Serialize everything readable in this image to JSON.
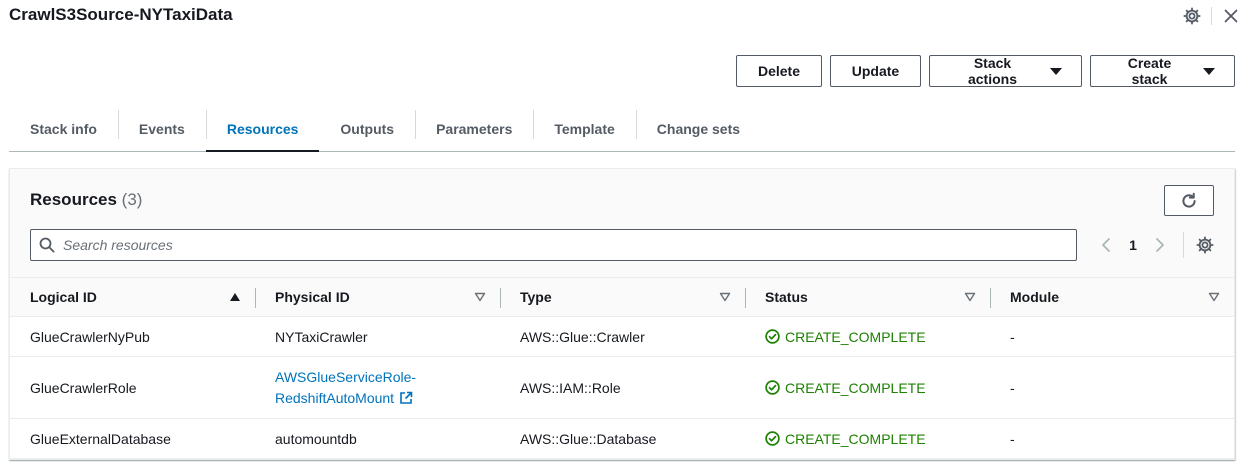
{
  "header": {
    "title": "CrawlS3Source-NYTaxiData",
    "icons": [
      "gear-icon",
      "close-icon"
    ]
  },
  "actions": {
    "delete_label": "Delete",
    "update_label": "Update",
    "stack_actions_label": "Stack actions",
    "create_stack_label": "Create stack"
  },
  "tabs": [
    {
      "label": "Stack info",
      "active": false
    },
    {
      "label": "Events",
      "active": false
    },
    {
      "label": "Resources",
      "active": true
    },
    {
      "label": "Outputs",
      "active": false
    },
    {
      "label": "Parameters",
      "active": false
    },
    {
      "label": "Template",
      "active": false
    },
    {
      "label": "Change sets",
      "active": false
    }
  ],
  "resources": {
    "title": "Resources",
    "count": "(3)",
    "search_placeholder": "Search resources",
    "page": "1",
    "columns": [
      "Logical ID",
      "Physical ID",
      "Type",
      "Status",
      "Module"
    ],
    "sort": {
      "column": "Logical ID",
      "direction": "ascending"
    },
    "rows": [
      {
        "logical_id": "GlueCrawlerNyPub",
        "physical_id": "NYTaxiCrawler",
        "physical_id_2": "",
        "type": "AWS::Glue::Crawler",
        "status": "CREATE_COMPLETE",
        "module": "-"
      },
      {
        "logical_id": "GlueCrawlerRole",
        "physical_id": "AWSGlueServiceRole-",
        "physical_id_2": "RedshiftAutoMount",
        "type": "AWS::IAM::Role",
        "status": "CREATE_COMPLETE",
        "module": "-"
      },
      {
        "logical_id": "GlueExternalDatabase",
        "physical_id": "automountdb",
        "physical_id_2": "",
        "type": "AWS::Glue::Database",
        "status": "CREATE_COMPLETE",
        "module": "-"
      }
    ]
  },
  "colors": {
    "link": "#0073bb",
    "success": "#1d8102",
    "text": "#16191f",
    "muted": "#687078"
  }
}
